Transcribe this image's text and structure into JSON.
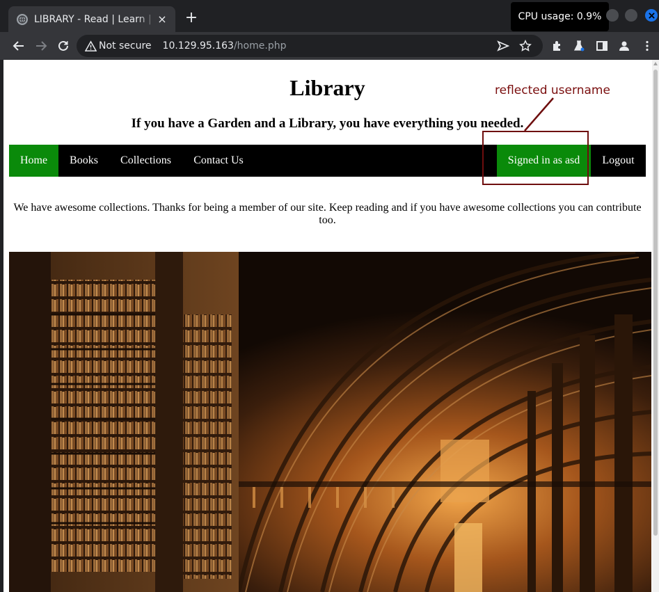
{
  "browser": {
    "tab_title": "LIBRARY - Read | Learn | Have Fun",
    "tab_close": "×",
    "new_tab": "+",
    "cpu_tooltip": "CPU usage: 0.9%",
    "security_label": "Not secure",
    "url_host": "10.129.95.163",
    "url_path": "/home.php"
  },
  "page": {
    "title": "Library",
    "subtitle": "If you have a Garden and a Library, you have everything you needed.",
    "nav": {
      "home": "Home",
      "books": "Books",
      "collections": "Collections",
      "contact": "Contact Us",
      "signed_in": "Signed in as asd",
      "logout": "Logout"
    },
    "intro": "We have awesome collections. Thanks for being a member of our site. Keep reading and if you have awesome collections you can contribute too."
  },
  "annotation": {
    "label": "reflected username",
    "color": "#6e0e0e"
  },
  "colors": {
    "nav_active": "#0a8a0a",
    "nav_bg": "#000000"
  }
}
